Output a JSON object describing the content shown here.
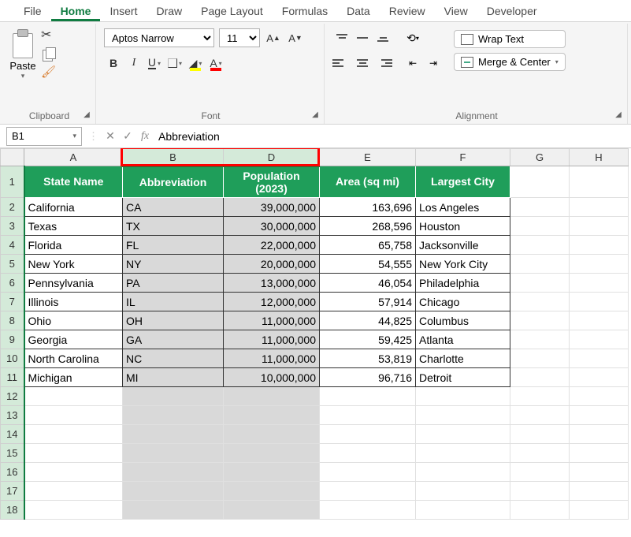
{
  "tabs": {
    "file": "File",
    "home": "Home",
    "insert": "Insert",
    "draw": "Draw",
    "page_layout": "Page Layout",
    "formulas": "Formulas",
    "data": "Data",
    "review": "Review",
    "view": "View",
    "developer": "Developer"
  },
  "ribbon": {
    "clipboard": {
      "paste": "Paste",
      "label": "Clipboard"
    },
    "font": {
      "name": "Aptos Narrow",
      "size": "11",
      "bold": "B",
      "italic": "I",
      "underline": "U",
      "fill": "A",
      "color": "A",
      "label": "Font"
    },
    "alignment": {
      "wrap": "Wrap Text",
      "merge": "Merge & Center",
      "label": "Alignment"
    }
  },
  "namebox": "B1",
  "formula": "Abbreviation",
  "columns": {
    "A": "A",
    "B": "B",
    "D": "D",
    "E": "E",
    "F": "F",
    "G": "G",
    "H": "H"
  },
  "headers": {
    "A": "State Name",
    "B": "Abbreviation",
    "D": "Population (2023)",
    "E": "Area (sq mi)",
    "F": "Largest City"
  },
  "rows": [
    {
      "r": "2",
      "A": "California",
      "B": "CA",
      "D": "39,000,000",
      "E": "163,696",
      "F": "Los Angeles"
    },
    {
      "r": "3",
      "A": "Texas",
      "B": "TX",
      "D": "30,000,000",
      "E": "268,596",
      "F": "Houston"
    },
    {
      "r": "4",
      "A": "Florida",
      "B": "FL",
      "D": "22,000,000",
      "E": "65,758",
      "F": "Jacksonville"
    },
    {
      "r": "5",
      "A": "New York",
      "B": "NY",
      "D": "20,000,000",
      "E": "54,555",
      "F": "New York City"
    },
    {
      "r": "6",
      "A": "Pennsylvania",
      "B": "PA",
      "D": "13,000,000",
      "E": "46,054",
      "F": "Philadelphia"
    },
    {
      "r": "7",
      "A": "Illinois",
      "B": "IL",
      "D": "12,000,000",
      "E": "57,914",
      "F": "Chicago"
    },
    {
      "r": "8",
      "A": "Ohio",
      "B": "OH",
      "D": "11,000,000",
      "E": "44,825",
      "F": "Columbus"
    },
    {
      "r": "9",
      "A": "Georgia",
      "B": "GA",
      "D": "11,000,000",
      "E": "59,425",
      "F": "Atlanta"
    },
    {
      "r": "10",
      "A": "North Carolina",
      "B": "NC",
      "D": "11,000,000",
      "E": "53,819",
      "F": "Charlotte"
    },
    {
      "r": "11",
      "A": "Michigan",
      "B": "MI",
      "D": "10,000,000",
      "E": "96,716",
      "F": "Detroit"
    }
  ],
  "empty_rows": [
    "12",
    "13",
    "14",
    "15",
    "16",
    "17",
    "18"
  ],
  "header_row_label": "1"
}
